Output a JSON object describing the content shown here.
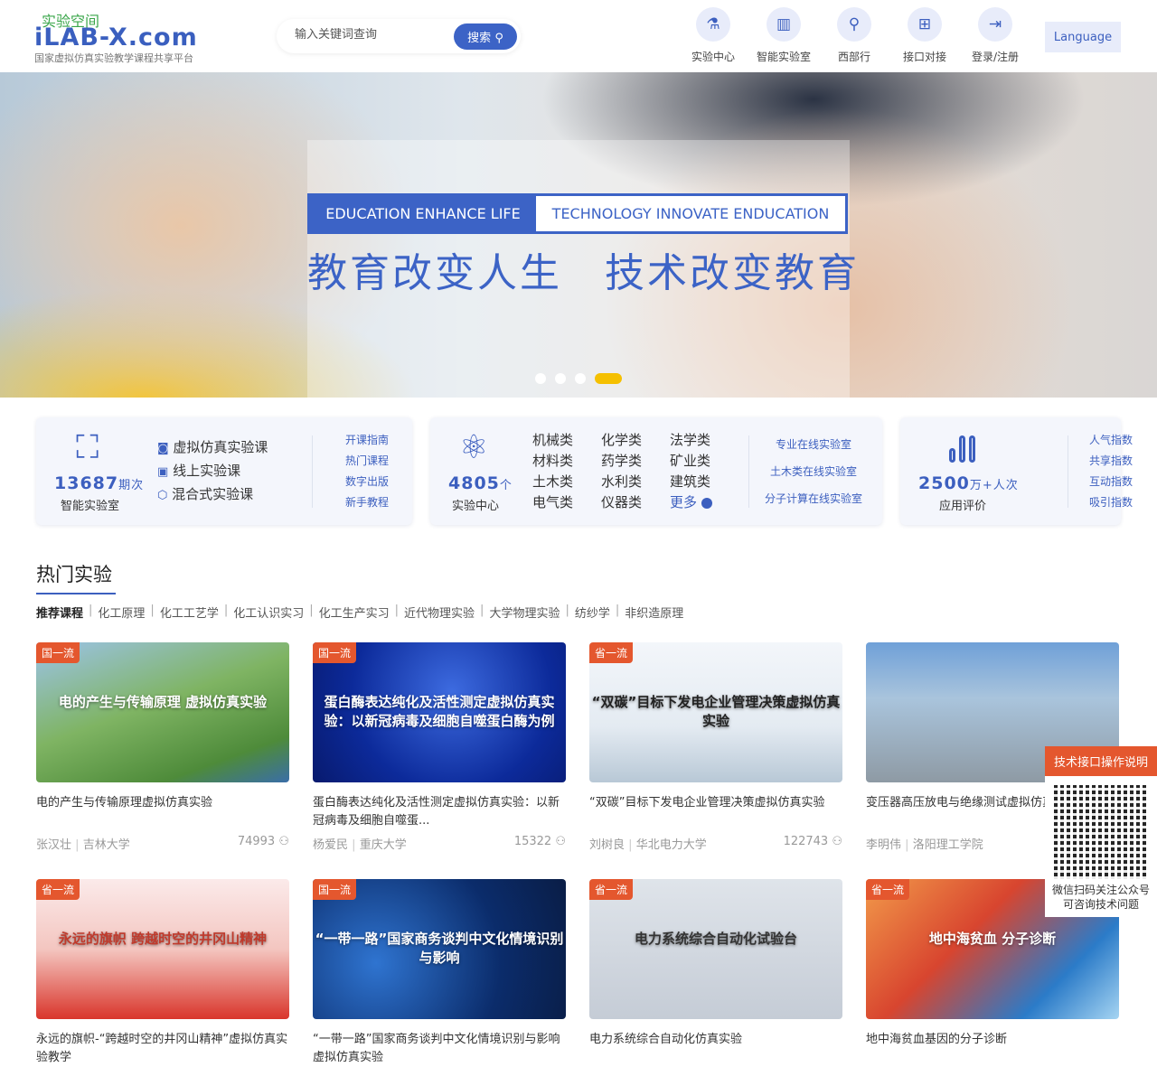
{
  "header": {
    "logo_cn": "实验空间",
    "logo_en": "iLAB-X.com",
    "logo_sub": "国家虚拟仿真实验教学课程共享平台",
    "search_placeholder": "输入关键词查询",
    "search_button": "搜索",
    "nav": [
      {
        "label": "实验中心",
        "icon": "flask-icon"
      },
      {
        "label": "智能实验室",
        "icon": "book-icon"
      },
      {
        "label": "西部行",
        "icon": "map-pin-icon"
      },
      {
        "label": "接口对接",
        "icon": "network-icon"
      },
      {
        "label": "登录/注册",
        "icon": "login-icon"
      }
    ],
    "language": "Language"
  },
  "banner": {
    "slogan_en_1": "EDUCATION ENHANCE LIFE",
    "slogan_en_2": "TECHNOLOGY INNOVATE ENDUCATION",
    "slogan_cn": "教育改变人生　技术改变教育",
    "slides": 4,
    "active_slide": 4
  },
  "stats": {
    "lab": {
      "num": "13687",
      "unit": "期次",
      "caption": "智能实验室",
      "courses": [
        "虚拟仿真实验课",
        "线上实验课",
        "混合式实验课"
      ],
      "links": [
        "开课指南",
        "热门课程",
        "数字出版",
        "新手教程"
      ]
    },
    "center": {
      "num": "4805",
      "unit": "个",
      "caption": "实验中心",
      "categories": [
        "机械类",
        "化学类",
        "法学类",
        "材料类",
        "药学类",
        "矿业类",
        "土木类",
        "水利类",
        "建筑类",
        "电气类",
        "仪器类",
        "更多"
      ],
      "links": [
        "专业在线实验室",
        "土木类在线实验室",
        "分子计算在线实验室"
      ]
    },
    "eval": {
      "num": "2500",
      "unit": "万+人次",
      "caption": "应用评价",
      "links": [
        "人气指数",
        "共享指数",
        "互动指数",
        "吸引指数"
      ]
    }
  },
  "hot": {
    "title": "热门实验",
    "tabs": [
      "推荐课程",
      "化工原理",
      "化工工艺学",
      "化工认识实习",
      "化工生产实习",
      "近代物理实验",
      "大学物理实验",
      "纺纱学",
      "非织造原理"
    ],
    "cards": [
      {
        "badge": "国一流",
        "title": "电的产生与传输原理虚拟仿真实验",
        "author": "张汉壮",
        "school": "吉林大学",
        "views": "74993",
        "overlay": "电的产生与传输原理 虚拟仿真实验"
      },
      {
        "badge": "国一流",
        "title": "蛋白酶表达纯化及活性测定虚拟仿真实验：以新冠病毒及细胞自噬蛋...",
        "author": "杨爱民",
        "school": "重庆大学",
        "views": "15322",
        "overlay": "蛋白酶表达纯化及活性测定虚拟仿真实验：以新冠病毒及细胞自噬蛋白酶为例"
      },
      {
        "badge": "省一流",
        "title": "“双碳”目标下发电企业管理决策虚拟仿真实验",
        "author": "刘树良",
        "school": "华北电力大学",
        "views": "122743",
        "overlay": "“双碳”目标下发电企业管理决策虚拟仿真实验"
      },
      {
        "badge": "",
        "title": "变压器高压放电与绝缘测试虚拟仿真实验",
        "author": "李明伟",
        "school": "洛阳理工学院",
        "views": "",
        "overlay": ""
      },
      {
        "badge": "省一流",
        "title": "永远的旗帜-“跨越时空的井冈山精神”虚拟仿真实验教学",
        "overlay": "永远的旗帜 跨越时空的井冈山精神"
      },
      {
        "badge": "国一流",
        "title": "“一带一路”国家商务谈判中文化情境识别与影响虚拟仿真实验",
        "overlay": "“一带一路”国家商务谈判中文化情境识别与影响"
      },
      {
        "badge": "省一流",
        "title": "电力系统综合自动化仿真实验",
        "overlay": "电力系统综合自动化试验台"
      },
      {
        "badge": "省一流",
        "title": "地中海贫血基因的分子诊断",
        "overlay": "地中海贫血 分子诊断"
      }
    ]
  },
  "float": {
    "header": "技术接口操作说明",
    "text": "微信扫码关注公众号可咨询技术问题"
  },
  "colors": {
    "primary": "#3c63c6",
    "badge": "#e4572e",
    "dot_active": "#f5c000"
  }
}
